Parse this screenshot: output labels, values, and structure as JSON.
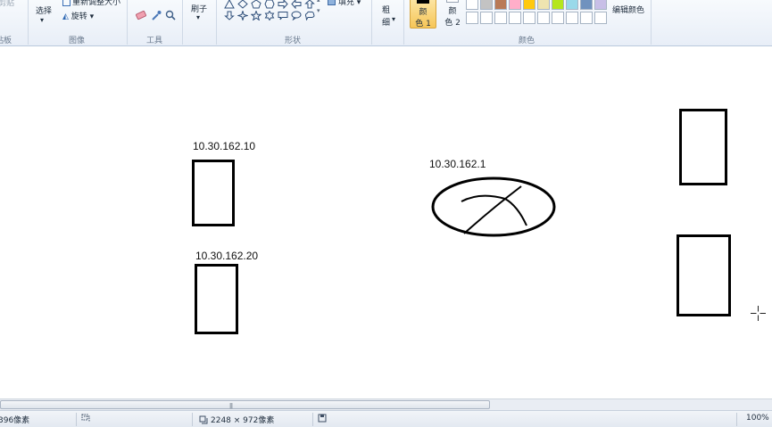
{
  "ribbon": {
    "clipboard_label": "剪贴板",
    "image_group": {
      "select_label": "选择",
      "resize_label": "重新调整大小",
      "rotate_label": "旋转",
      "group_label": "图像"
    },
    "tools_group": {
      "group_label": "工具"
    },
    "brushes": {
      "label": "刷子"
    },
    "shapes_group": {
      "fill_label": "填充",
      "group_label": "形状"
    },
    "size": {
      "label_top": "粗",
      "label_bottom": "细"
    },
    "colors_group": {
      "color1_top": "颜",
      "color1_bottom": "色 1",
      "color2_top": "颜",
      "color2_bottom": "色 2",
      "edit_colors_label": "编辑颜色",
      "group_label": "颜色",
      "color1_value": "#000000",
      "color2_value": "#ffffff",
      "palette": [
        "#ffffff",
        "#c3c3c3",
        "#b97a57",
        "#ffaec9",
        "#ffc90e",
        "#efe4b0",
        "#b5e61d",
        "#99d9ea",
        "#7092be",
        "#c8bfe7",
        "#ffffff",
        "#ffffff",
        "#ffffff",
        "#ffffff",
        "#ffffff",
        "#ffffff",
        "#ffffff",
        "#ffffff",
        "#ffffff",
        "#ffffff"
      ]
    }
  },
  "canvas": {
    "labels": {
      "host1": "10.30.162.10",
      "host2": "10.30.162.20",
      "router": "10.30.162.1"
    }
  },
  "statusbar": {
    "cursor_position": "396像素",
    "image_size": "2248 × 972像素",
    "zoom": "100%"
  }
}
